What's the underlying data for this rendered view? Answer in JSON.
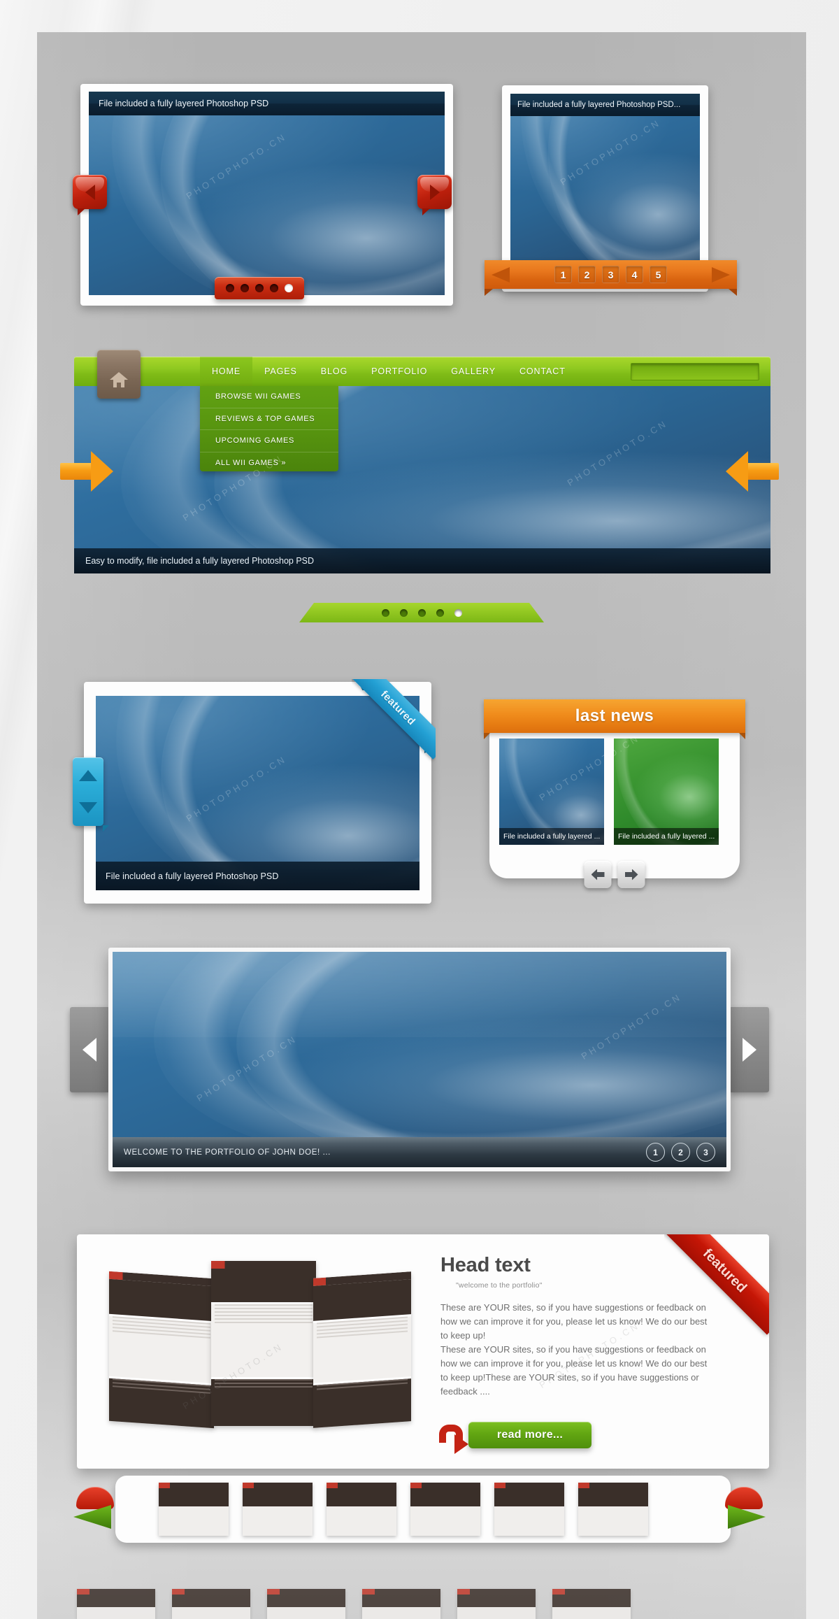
{
  "panel1": {
    "title": "File included a fully layered Photoshop PSD",
    "prev_label": "◀",
    "next_label": "▶",
    "dots": [
      "1",
      "2",
      "3",
      "4",
      "5"
    ],
    "active_dot": 4
  },
  "panel2": {
    "title": "File included a fully layered Photoshop PSD...",
    "pagination": [
      "1",
      "2",
      "3",
      "4",
      "5"
    ],
    "active_page": "1",
    "prev_label": "prev-arrow",
    "next_label": "next-arrow"
  },
  "nav_slider": {
    "home_icon": "home-icon",
    "menu": [
      {
        "label": "HOME",
        "active": true
      },
      {
        "label": "PAGES",
        "active": false
      },
      {
        "label": "BLOG",
        "active": false
      },
      {
        "label": "PORTFOLIO",
        "active": false
      },
      {
        "label": "GALLERY",
        "active": false
      },
      {
        "label": "CONTACT",
        "active": false
      }
    ],
    "search_value": "",
    "search_placeholder": "",
    "dropdown": [
      "BROWSE WII GAMES",
      "REVIEWS & TOP GAMES",
      "UPCOMING GAMES",
      "ALL WII GAMES »"
    ],
    "caption": "Easy to modify, file included a fully layered Photoshop PSD",
    "dots": [
      "1",
      "2",
      "3",
      "4",
      "5"
    ],
    "active_dot": 5,
    "accent_green": "#8ec820",
    "accent_orange": "#f79c14"
  },
  "featured_panel": {
    "ribbon": "featured",
    "caption": "File included a fully layered Photoshop PSD",
    "scroll_up": "up-arrow",
    "scroll_down": "down-arrow",
    "ribbon_color": "#23a0d4"
  },
  "last_news": {
    "title": "last news",
    "items": [
      {
        "caption": "File included a fully layered ...",
        "color": "blue"
      },
      {
        "caption": "File included a fully layered ...",
        "color": "green"
      }
    ],
    "prev_label": "prev-arrow",
    "next_label": "next-arrow",
    "header_color": "#f08c1c"
  },
  "portfolio_slider": {
    "caption": "WELCOME TO THE PORTFOLIO OF JOHN DOE! ...",
    "pages": [
      "1",
      "2",
      "3"
    ],
    "prev_label": "◀",
    "next_label": "▶"
  },
  "head_card": {
    "title": "Head text",
    "subtitle": "\"welcome to the portfolio\"",
    "paragraph1": "These are YOUR sites, so if you have suggestions or feedback on how we can improve it for you, please let us know! We do our best to keep up!",
    "paragraph2": "These are YOUR sites, so if you have suggestions or feedback on how we can improve it for you, please let us know! We do our best to keep up!These are YOUR sites, so if you have suggestions or feedback ....",
    "read_more": "read more...",
    "ribbon": "featured",
    "ribbon_color": "#c51606",
    "button_color": "#62a612"
  },
  "carousel": {
    "prev_label": "prev-arrow",
    "next_label": "next-arrow",
    "thumb_count": 6
  },
  "watermark": "PHOTOPHOTO.CN"
}
